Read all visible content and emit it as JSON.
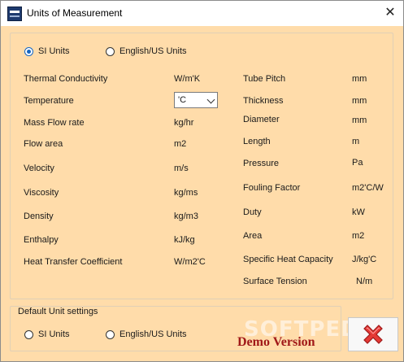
{
  "window": {
    "title": "Units of Measurement",
    "close_glyph": "✕"
  },
  "unit_system": {
    "si_label": "SI Units",
    "english_label": "English/US Units",
    "selected": "si"
  },
  "left_rows": [
    {
      "name": "Thermal Conductivity",
      "unit": "W/m'K"
    },
    {
      "name": "Temperature",
      "unit": "'C"
    },
    {
      "name": "Mass Flow rate",
      "unit": "kg/hr"
    },
    {
      "name": "Flow area",
      "unit": "m2"
    },
    {
      "name": "Velocity",
      "unit": "m/s"
    },
    {
      "name": "Viscosity",
      "unit": "kg/ms"
    },
    {
      "name": "Density",
      "unit": "kg/m3"
    },
    {
      "name": "Enthalpy",
      "unit": "kJ/kg"
    },
    {
      "name": "Heat Transfer Coefficient",
      "unit": "W/m2'C"
    }
  ],
  "right_rows": [
    {
      "name": "Tube Pitch",
      "unit": "mm"
    },
    {
      "name": "Thickness",
      "unit": "mm"
    },
    {
      "name": "Diameter",
      "unit": "mm"
    },
    {
      "name": "Length",
      "unit": "m"
    },
    {
      "name": "Pressure",
      "unit": "Pa"
    },
    {
      "name": "Fouling Factor",
      "unit": "m2'C/W"
    },
    {
      "name": "Duty",
      "unit": "kW"
    },
    {
      "name": "Area",
      "unit": "m2"
    },
    {
      "name": "Specific Heat Capacity",
      "unit": "J/kg'C"
    },
    {
      "name": "Surface Tension",
      "unit": "N/m"
    }
  ],
  "default_settings": {
    "title": "Default Unit settings",
    "si_label": "SI Units",
    "english_label": "English/US Units"
  },
  "demo_label": "Demo Version",
  "watermark": "SOFTPEDIA",
  "colors": {
    "background": "#ffdcaa",
    "accent": "#1565c0",
    "demo": "#a01818",
    "close_icon": "#e53935"
  },
  "icons": {
    "app": "app-logo-icon",
    "close": "red-x-icon"
  }
}
